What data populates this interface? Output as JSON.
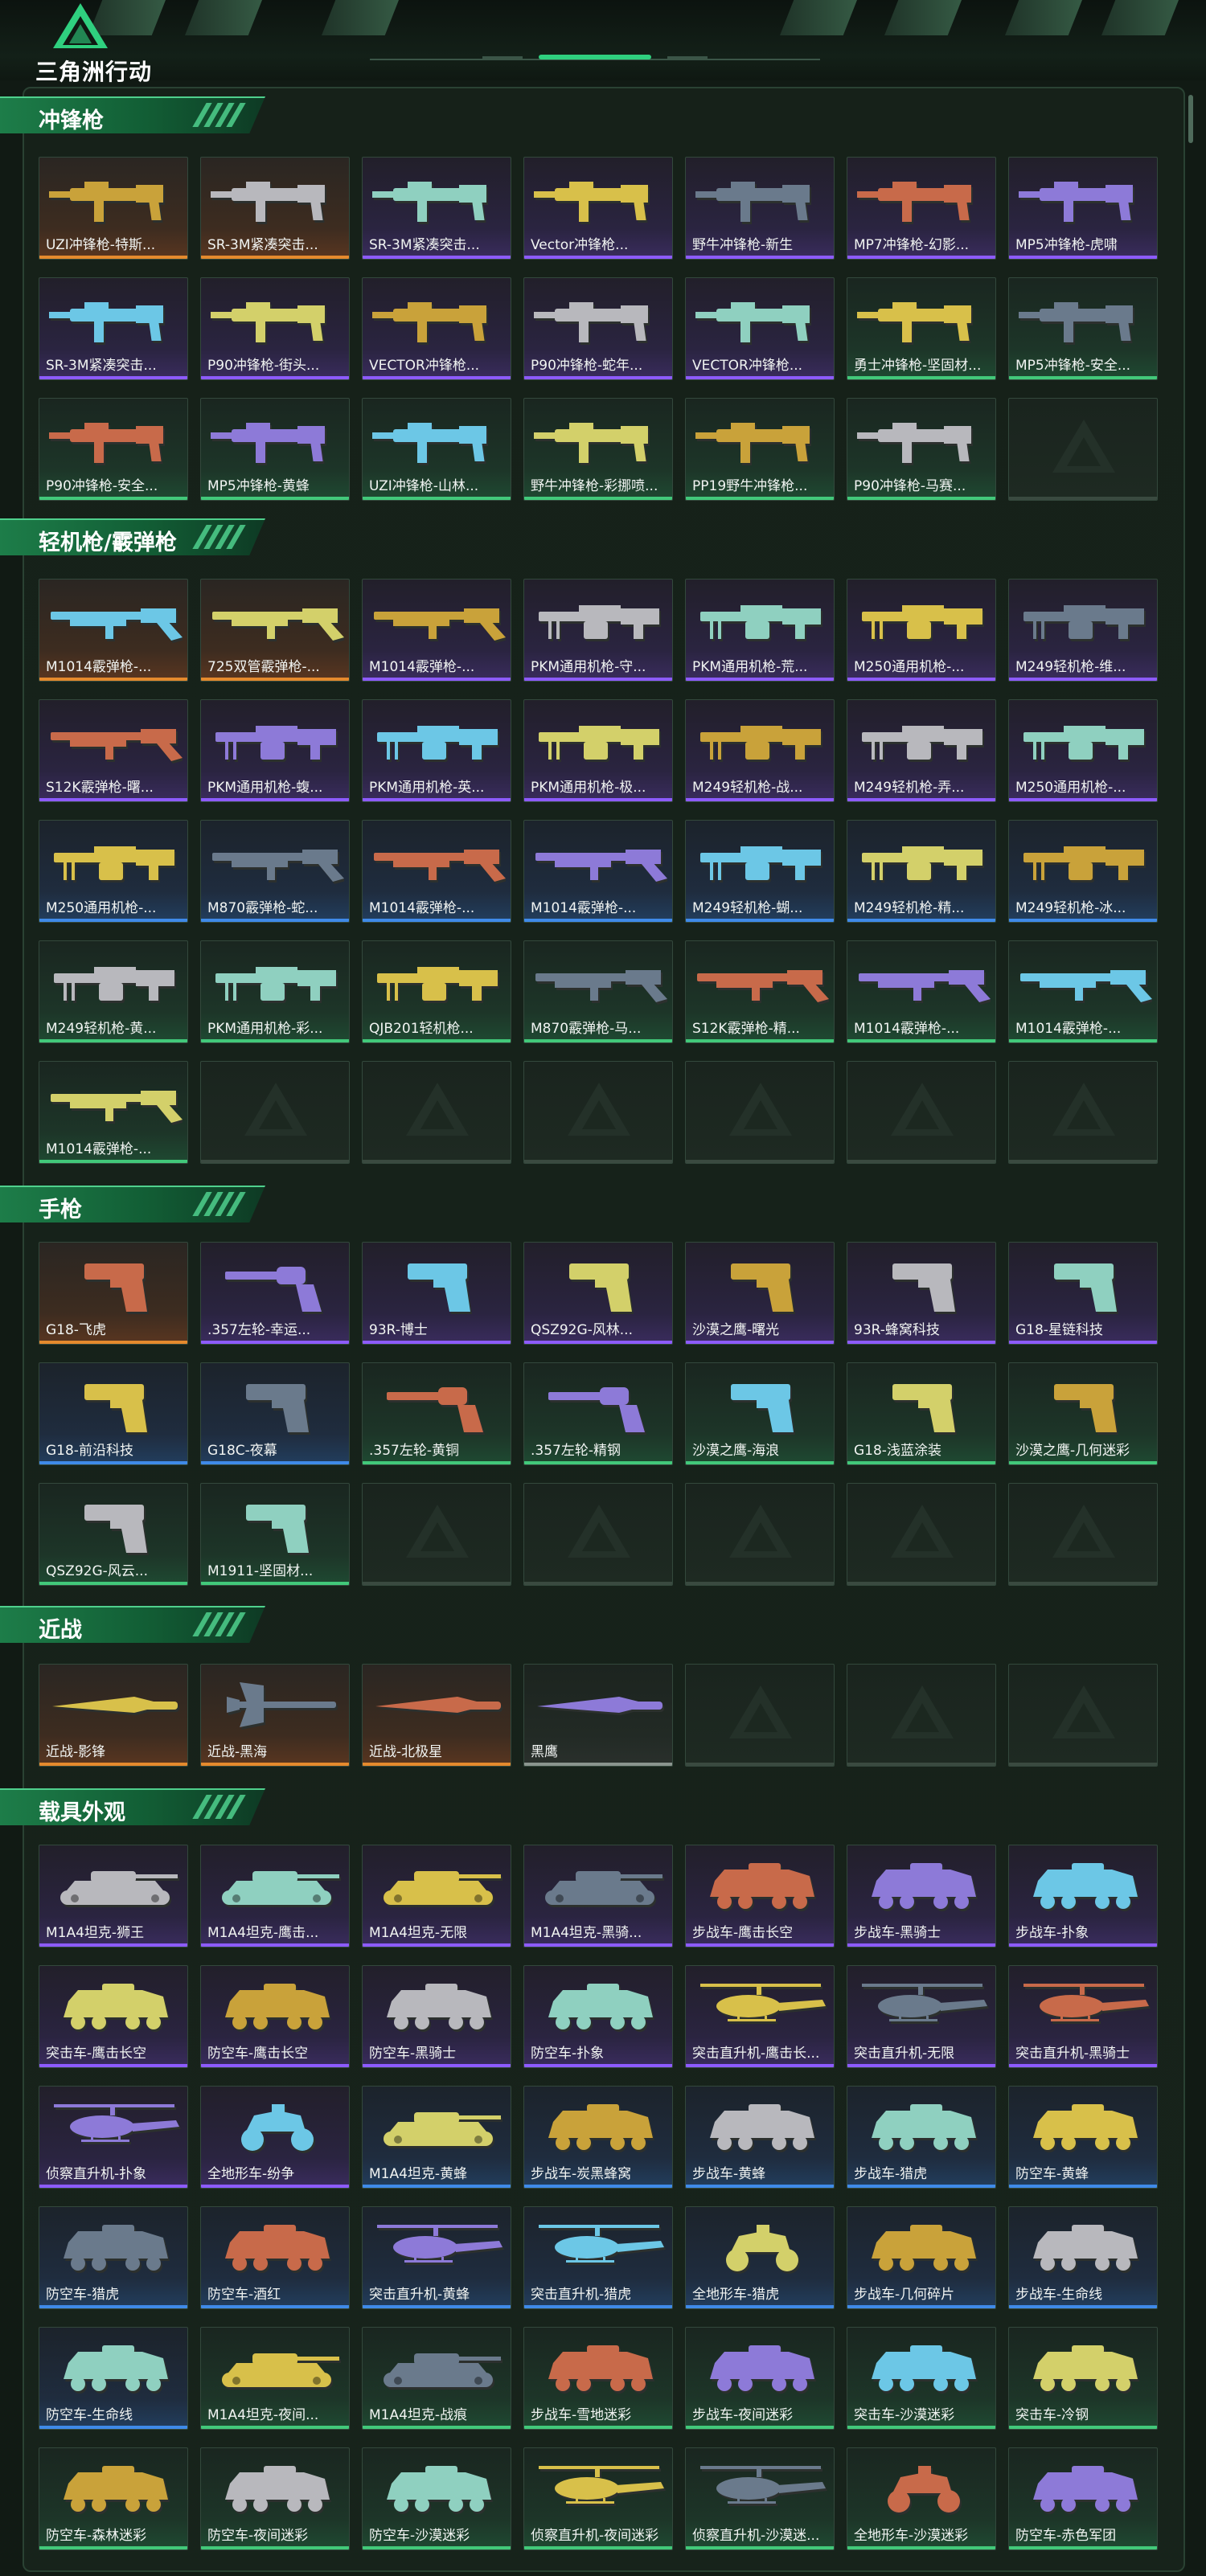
{
  "brand": {
    "logo_text": "三角洲行动",
    "accent": "#2fd07f"
  },
  "rarity_colors": {
    "orange": "#e58a2d",
    "purple": "#8d5bff",
    "blue": "#3f8ae8",
    "green": "#42c97a",
    "gray": "#8a948e"
  },
  "sections": [
    {
      "title": "冲锋枪",
      "kind": "gun",
      "slots": 21,
      "items": [
        {
          "name": "UZI冲锋枪-特斯...",
          "rarity": "orange",
          "icon": "smg-icon"
        },
        {
          "name": "SR-3M紧凑突击...",
          "rarity": "orange",
          "icon": "smg-icon"
        },
        {
          "name": "SR-3M紧凑突击...",
          "rarity": "purple",
          "icon": "smg-icon"
        },
        {
          "name": "Vector冲锋枪...",
          "rarity": "purple",
          "icon": "smg-icon"
        },
        {
          "name": "野牛冲锋枪-新生",
          "rarity": "purple",
          "icon": "smg-icon"
        },
        {
          "name": "MP7冲锋枪-幻影...",
          "rarity": "purple",
          "icon": "smg-icon"
        },
        {
          "name": "MP5冲锋枪-虎啸",
          "rarity": "purple",
          "icon": "smg-icon"
        },
        {
          "name": "SR-3M紧凑突击...",
          "rarity": "purple",
          "icon": "smg-icon"
        },
        {
          "name": "P90冲锋枪-街头...",
          "rarity": "purple",
          "icon": "smg-icon"
        },
        {
          "name": "VECTOR冲锋枪...",
          "rarity": "purple",
          "icon": "smg-icon"
        },
        {
          "name": "P90冲锋枪-蛇年...",
          "rarity": "purple",
          "icon": "smg-icon"
        },
        {
          "name": "VECTOR冲锋枪...",
          "rarity": "purple",
          "icon": "smg-icon"
        },
        {
          "name": "勇士冲锋枪-坚固材...",
          "rarity": "green",
          "icon": "smg-icon"
        },
        {
          "name": "MP5冲锋枪-安全...",
          "rarity": "green",
          "icon": "smg-icon"
        },
        {
          "name": "P90冲锋枪-安全...",
          "rarity": "green",
          "icon": "smg-icon"
        },
        {
          "name": "MP5冲锋枪-黄蜂",
          "rarity": "green",
          "icon": "smg-icon"
        },
        {
          "name": "UZI冲锋枪-山林...",
          "rarity": "green",
          "icon": "smg-icon"
        },
        {
          "name": "野牛冲锋枪-彩挪喷...",
          "rarity": "green",
          "icon": "smg-icon"
        },
        {
          "name": "PP19野牛冲锋枪...",
          "rarity": "green",
          "icon": "smg-icon"
        },
        {
          "name": "P90冲锋枪-马赛...",
          "rarity": "green",
          "icon": "smg-icon"
        }
      ]
    },
    {
      "title": "轻机枪/霰弹枪",
      "kind": "gun",
      "slots": 35,
      "items": [
        {
          "name": "M1014霰弹枪-...",
          "rarity": "orange",
          "icon": "shotgun-icon"
        },
        {
          "name": "725双管霰弹枪-...",
          "rarity": "orange",
          "icon": "shotgun-icon"
        },
        {
          "name": "M1014霰弹枪-...",
          "rarity": "purple",
          "icon": "shotgun-icon"
        },
        {
          "name": "PKM通用机枪-守...",
          "rarity": "purple",
          "icon": "machine-gun-icon"
        },
        {
          "name": "PKM通用机枪-荒...",
          "rarity": "purple",
          "icon": "machine-gun-icon"
        },
        {
          "name": "M250通用机枪-...",
          "rarity": "purple",
          "icon": "machine-gun-icon"
        },
        {
          "name": "M249轻机枪-维...",
          "rarity": "purple",
          "icon": "machine-gun-icon"
        },
        {
          "name": "S12K霰弹枪-曙...",
          "rarity": "purple",
          "icon": "shotgun-icon"
        },
        {
          "name": "PKM通用机枪-蝮...",
          "rarity": "purple",
          "icon": "machine-gun-icon"
        },
        {
          "name": "PKM通用机枪-英...",
          "rarity": "purple",
          "icon": "machine-gun-icon"
        },
        {
          "name": "PKM通用机枪-极...",
          "rarity": "purple",
          "icon": "machine-gun-icon"
        },
        {
          "name": "M249轻机枪-战...",
          "rarity": "purple",
          "icon": "machine-gun-icon"
        },
        {
          "name": "M249轻机枪-弄...",
          "rarity": "purple",
          "icon": "machine-gun-icon"
        },
        {
          "name": "M250通用机枪-...",
          "rarity": "purple",
          "icon": "machine-gun-icon"
        },
        {
          "name": "M250通用机枪-...",
          "rarity": "blue",
          "icon": "machine-gun-icon"
        },
        {
          "name": "M870霰弹枪-蛇...",
          "rarity": "blue",
          "icon": "shotgun-icon"
        },
        {
          "name": "M1014霰弹枪-...",
          "rarity": "blue",
          "icon": "shotgun-icon"
        },
        {
          "name": "M1014霰弹枪-...",
          "rarity": "blue",
          "icon": "shotgun-icon"
        },
        {
          "name": "M249轻机枪-蝴...",
          "rarity": "blue",
          "icon": "machine-gun-icon"
        },
        {
          "name": "M249轻机枪-精...",
          "rarity": "blue",
          "icon": "machine-gun-icon"
        },
        {
          "name": "M249轻机枪-冰...",
          "rarity": "blue",
          "icon": "machine-gun-icon"
        },
        {
          "name": "M249轻机枪-黄...",
          "rarity": "green",
          "icon": "machine-gun-icon"
        },
        {
          "name": "PKM通用机枪-彩...",
          "rarity": "green",
          "icon": "machine-gun-icon"
        },
        {
          "name": "QJB201轻机枪...",
          "rarity": "green",
          "icon": "machine-gun-icon"
        },
        {
          "name": "M870霰弹枪-马...",
          "rarity": "green",
          "icon": "shotgun-icon"
        },
        {
          "name": "S12K霰弹枪-精...",
          "rarity": "green",
          "icon": "shotgun-icon"
        },
        {
          "name": "M1014霰弹枪-...",
          "rarity": "green",
          "icon": "shotgun-icon"
        },
        {
          "name": "M1014霰弹枪-...",
          "rarity": "green",
          "icon": "shotgun-icon"
        },
        {
          "name": "M1014霰弹枪-...",
          "rarity": "green",
          "icon": "shotgun-icon"
        }
      ]
    },
    {
      "title": "手枪",
      "kind": "pistol",
      "slots": 21,
      "items": [
        {
          "name": "G18-飞虎",
          "rarity": "orange",
          "icon": "pistol-icon"
        },
        {
          "name": ".357左轮-幸运...",
          "rarity": "purple",
          "icon": "revolver-icon"
        },
        {
          "name": "93R-博士",
          "rarity": "purple",
          "icon": "pistol-icon"
        },
        {
          "name": "QSZ92G-风林...",
          "rarity": "purple",
          "icon": "pistol-icon"
        },
        {
          "name": "沙漠之鹰-曙光",
          "rarity": "purple",
          "icon": "pistol-icon"
        },
        {
          "name": "93R-蜂窝科技",
          "rarity": "purple",
          "icon": "pistol-icon"
        },
        {
          "name": "G18-星链科技",
          "rarity": "purple",
          "icon": "pistol-icon"
        },
        {
          "name": "G18-前沿科技",
          "rarity": "blue",
          "icon": "pistol-icon"
        },
        {
          "name": "G18C-夜幕",
          "rarity": "blue",
          "icon": "pistol-icon"
        },
        {
          "name": ".357左轮-黄铜",
          "rarity": "green",
          "icon": "revolver-icon"
        },
        {
          "name": ".357左轮-精钢",
          "rarity": "green",
          "icon": "revolver-icon"
        },
        {
          "name": "沙漠之鹰-海浪",
          "rarity": "green",
          "icon": "pistol-icon"
        },
        {
          "name": "G18-浅蓝涂装",
          "rarity": "green",
          "icon": "pistol-icon"
        },
        {
          "name": "沙漠之鹰-几何迷彩",
          "rarity": "green",
          "icon": "pistol-icon"
        },
        {
          "name": "QSZ92G-风云...",
          "rarity": "green",
          "icon": "pistol-icon"
        },
        {
          "name": "M1911-坚固材...",
          "rarity": "green",
          "icon": "pistol-icon"
        }
      ]
    },
    {
      "title": "近战",
      "kind": "melee",
      "slots": 7,
      "items": [
        {
          "name": "近战-影锋",
          "rarity": "orange",
          "icon": "knife-icon"
        },
        {
          "name": "近战-黑海",
          "rarity": "orange",
          "icon": "axe-icon"
        },
        {
          "name": "近战-北极星",
          "rarity": "orange",
          "icon": "knife-icon"
        },
        {
          "name": "黑鹰",
          "rarity": "gray",
          "icon": "knife-icon"
        }
      ]
    },
    {
      "title": "载具外观",
      "kind": "vehicle",
      "slots": 42,
      "items": [
        {
          "name": "M1A4坦克-狮王",
          "rarity": "purple",
          "icon": "tank-icon"
        },
        {
          "name": "M1A4坦克-鹰击...",
          "rarity": "purple",
          "icon": "tank-icon"
        },
        {
          "name": "M1A4坦克-无限",
          "rarity": "purple",
          "icon": "tank-icon"
        },
        {
          "name": "M1A4坦克-黑骑...",
          "rarity": "purple",
          "icon": "tank-icon"
        },
        {
          "name": "步战车-鹰击长空",
          "rarity": "purple",
          "icon": "apc-icon"
        },
        {
          "name": "步战车-黑骑士",
          "rarity": "purple",
          "icon": "apc-icon"
        },
        {
          "name": "步战车-扑象",
          "rarity": "purple",
          "icon": "apc-icon"
        },
        {
          "name": "突击车-鹰击长空",
          "rarity": "purple",
          "icon": "apc-icon"
        },
        {
          "name": "防空车-鹰击长空",
          "rarity": "purple",
          "icon": "apc-icon"
        },
        {
          "name": "防空车-黑骑士",
          "rarity": "purple",
          "icon": "apc-icon"
        },
        {
          "name": "防空车-扑象",
          "rarity": "purple",
          "icon": "apc-icon"
        },
        {
          "name": "突击直升机-鹰击长...",
          "rarity": "purple",
          "icon": "helicopter-icon"
        },
        {
          "name": "突击直升机-无限",
          "rarity": "purple",
          "icon": "helicopter-icon"
        },
        {
          "name": "突击直升机-黑骑士",
          "rarity": "purple",
          "icon": "helicopter-icon"
        },
        {
          "name": "侦察直升机-扑象",
          "rarity": "purple",
          "icon": "helicopter-icon"
        },
        {
          "name": "全地形车-纷争",
          "rarity": "purple",
          "icon": "atv-icon"
        },
        {
          "name": "M1A4坦克-黄蜂",
          "rarity": "blue",
          "icon": "tank-icon"
        },
        {
          "name": "步战车-炭黑蜂窝",
          "rarity": "blue",
          "icon": "apc-icon"
        },
        {
          "name": "步战车-黄蜂",
          "rarity": "blue",
          "icon": "apc-icon"
        },
        {
          "name": "步战车-猎虎",
          "rarity": "blue",
          "icon": "apc-icon"
        },
        {
          "name": "防空车-黄蜂",
          "rarity": "blue",
          "icon": "apc-icon"
        },
        {
          "name": "防空车-猎虎",
          "rarity": "blue",
          "icon": "apc-icon"
        },
        {
          "name": "防空车-酒红",
          "rarity": "blue",
          "icon": "apc-icon"
        },
        {
          "name": "突击直升机-黄蜂",
          "rarity": "blue",
          "icon": "helicopter-icon"
        },
        {
          "name": "突击直升机-猎虎",
          "rarity": "blue",
          "icon": "helicopter-icon"
        },
        {
          "name": "全地形车-猎虎",
          "rarity": "blue",
          "icon": "atv-icon"
        },
        {
          "name": "步战车-几何碎片",
          "rarity": "blue",
          "icon": "apc-icon"
        },
        {
          "name": "步战车-生命线",
          "rarity": "blue",
          "icon": "apc-icon"
        },
        {
          "name": "防空车-生命线",
          "rarity": "blue",
          "icon": "apc-icon"
        },
        {
          "name": "M1A4坦克-夜间...",
          "rarity": "green",
          "icon": "tank-icon"
        },
        {
          "name": "M1A4坦克-战痕",
          "rarity": "green",
          "icon": "tank-icon"
        },
        {
          "name": "步战车-雪地迷彩",
          "rarity": "green",
          "icon": "apc-icon"
        },
        {
          "name": "步战车-夜间迷彩",
          "rarity": "green",
          "icon": "apc-icon"
        },
        {
          "name": "突击车-沙漠迷彩",
          "rarity": "green",
          "icon": "apc-icon"
        },
        {
          "name": "突击车-冷钢",
          "rarity": "green",
          "icon": "apc-icon"
        },
        {
          "name": "防空车-森林迷彩",
          "rarity": "green",
          "icon": "apc-icon"
        },
        {
          "name": "防空车-夜间迷彩",
          "rarity": "green",
          "icon": "apc-icon"
        },
        {
          "name": "防空车-沙漠迷彩",
          "rarity": "green",
          "icon": "apc-icon"
        },
        {
          "name": "侦察直升机-夜间迷彩",
          "rarity": "green",
          "icon": "helicopter-icon"
        },
        {
          "name": "侦察直升机-沙漠迷...",
          "rarity": "green",
          "icon": "helicopter-icon"
        },
        {
          "name": "全地形车-沙漠迷彩",
          "rarity": "green",
          "icon": "atv-icon"
        },
        {
          "name": "防空车-赤色军团",
          "rarity": "green",
          "icon": "apc-icon"
        }
      ]
    }
  ]
}
